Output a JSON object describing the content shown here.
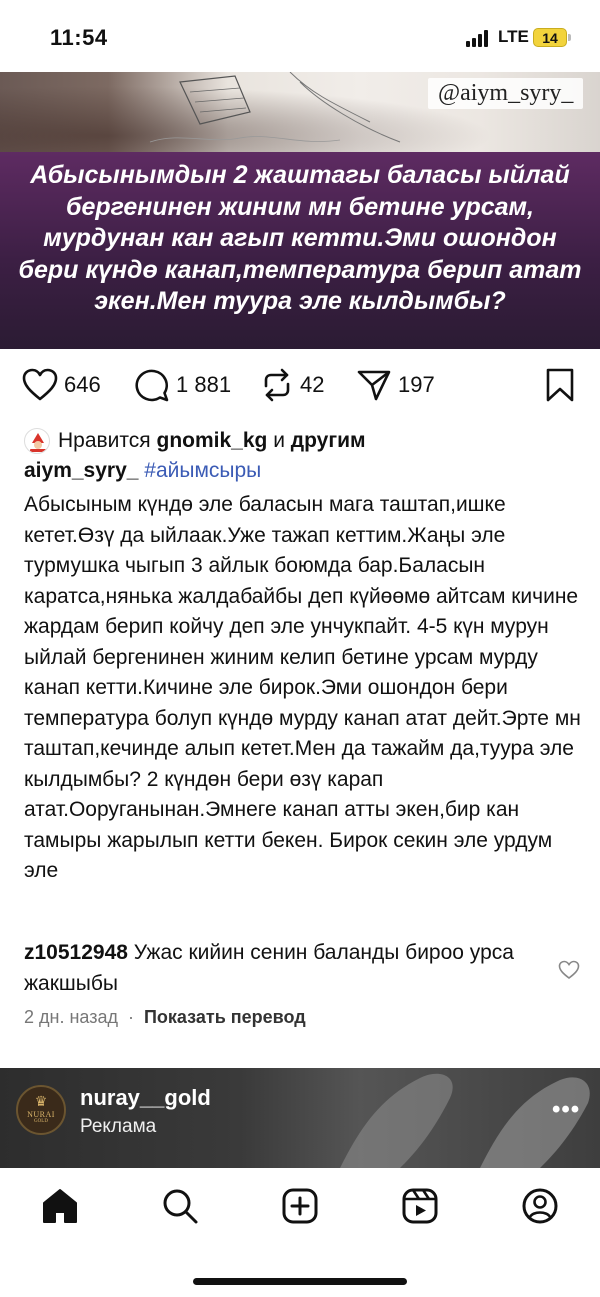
{
  "status_bar": {
    "time": "11:54",
    "network": "LTE",
    "battery": "14",
    "battery_color": "#f2d33c"
  },
  "post_image": {
    "watermark": "@aiym_syry_",
    "caption": "Абысынымдын 2 жаштагы баласы ыйлай бергенинен жиним мн бетине урсам, мурдунан кан агып кетти.Эми ошондон бери күндө канап,температура берип атат экен.Мен туура эле кылдымбы?",
    "caption_bg": "#3c1f44"
  },
  "actions": {
    "likes": "646",
    "comments": "1 881",
    "reposts": "42",
    "shares": "197",
    "icons": [
      "heart-icon",
      "comment-icon",
      "repost-icon",
      "send-icon",
      "bookmark-icon"
    ]
  },
  "likes_line": {
    "prefix": "Нравится",
    "user": "gnomik_kg",
    "connector": "и",
    "others": "другим"
  },
  "caption": {
    "user": "aiym_syry_",
    "hashtag": "#айымсыры",
    "text": "Абысыным күндө эле баласын мага таштап,ишке кетет.Өзү да ыйлаак.Уже тажап кеттим.Жаңы эле турмушка чыгып 3 айлык боюмда бар.Баласын каратса,нянька жалдабайбы деп күйөөмө айтсам кичине жардам берип койчу деп эле унчукпайт. 4-5 күн мурун ыйлай бергенинен жиним келип бетине урсам мурду канап кетти.Кичине эле бирок.Эми ошондон бери температура болуп күндө мурду канап атат дейт.Эрте мн таштап,кечинде алып кетет.Мен да тажайм да,туура эле кылдымбы? 2 күндөн бери өзү карап атат.Ооруганынан.Эмнеге канап атты экен,бир кан тамыры жарылып кетти бекен. Бирок секин эле урдум эле"
  },
  "comment": {
    "user": "z10512948",
    "text": "Ужас кийин сенин баланды бироо урса жакшыбы"
  },
  "meta": {
    "time_ago": "2 дн. назад",
    "separator": "·",
    "translate": "Показать перевод"
  },
  "ad": {
    "user": "nuray__gold",
    "label": "Реклама",
    "logo_name": "NURAI",
    "logo_sub": "GOLD",
    "more": "•••"
  },
  "bottom_nav": {
    "items": [
      "home-icon",
      "search-icon",
      "create-icon",
      "reels-icon",
      "profile-icon"
    ]
  }
}
